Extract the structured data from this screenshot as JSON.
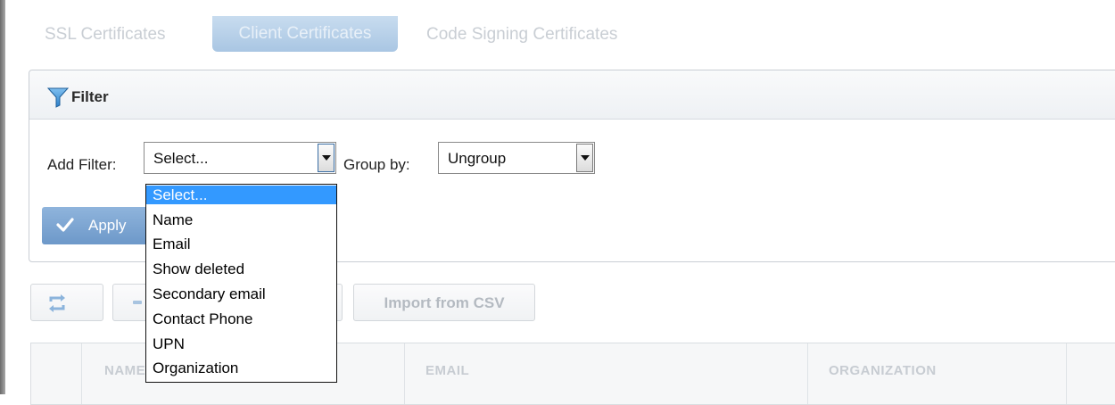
{
  "tabs": [
    {
      "label": "SSL Certificates"
    },
    {
      "label": "Client Certificates",
      "active": true
    },
    {
      "label": "Code Signing Certificates"
    }
  ],
  "filter": {
    "title": "Filter",
    "add_filter_label": "Add Filter:",
    "add_filter_value": "Select...",
    "group_by_label": "Group by:",
    "group_by_value": "Ungroup",
    "apply_label": "Apply"
  },
  "dropdown": {
    "options": [
      "Select...",
      "Name",
      "Email",
      "Show deleted",
      "Secondary email",
      "Contact Phone",
      "UPN",
      "Organization"
    ],
    "selected_index": 0
  },
  "toolbar": {
    "import_label": "Import from CSV"
  },
  "table": {
    "columns": [
      "NAME",
      "EMAIL",
      "ORGANIZATION"
    ]
  },
  "colors": {
    "accent": "#3399ff",
    "apply_button": "#7ea6d2",
    "active_tab": "#b8d1ea"
  }
}
